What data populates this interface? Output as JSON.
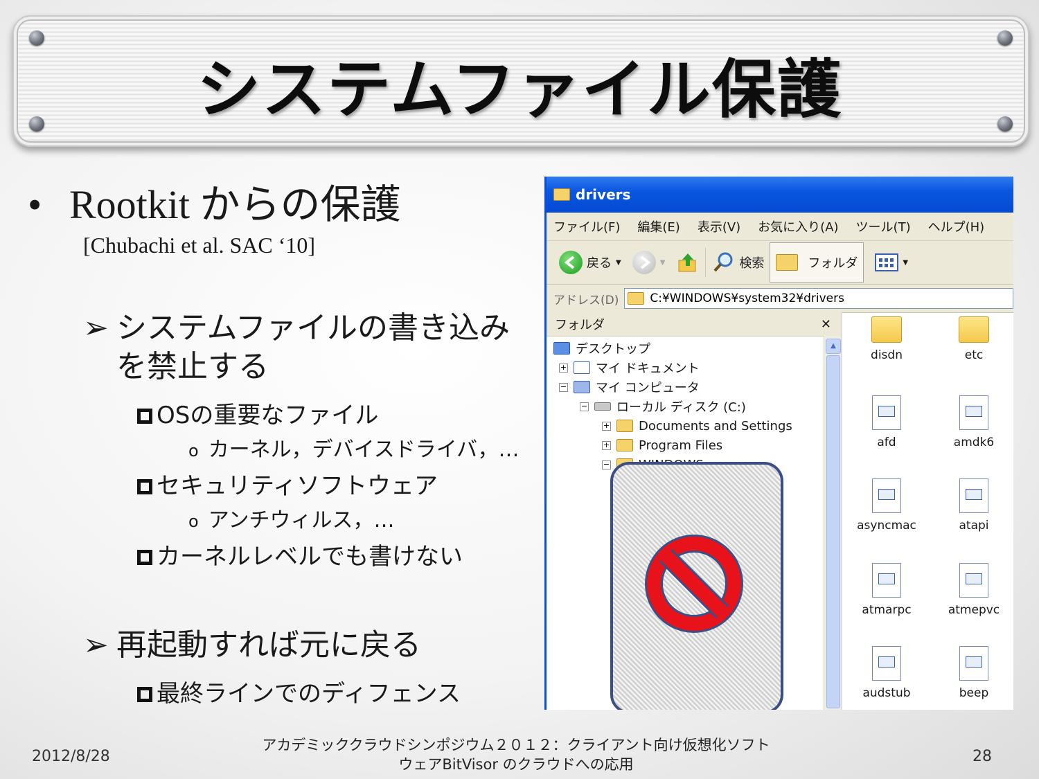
{
  "slide": {
    "title": "システムファイル保護",
    "bullet1": "Rootkit からの保護",
    "bullet1_marker": "•",
    "citation": "[Chubachi et al. SAC ‘10]",
    "sub1_line1": "システムファイルの書き込み",
    "sub1_line2": "を禁止する",
    "arrow": "➢",
    "items": [
      "OSの重要なファイル",
      "カーネル，デバイスドライバ，…",
      "セキュリティソフトウェア",
      "アンチウィルス，…",
      "カーネルレベルでも書けない"
    ],
    "sub2": "再起動すれば元に戻る",
    "sub2_item": "最終ラインでのディフェンス",
    "o_marker": "o"
  },
  "footer": {
    "date": "2012/8/28",
    "center_line1": "アカデミッククラウドシンポジウム２０１２：クライアント向け仮想化ソフト",
    "center_line2": "ウェアBitVisor のクラウドへの応用",
    "page": "28"
  },
  "explorer": {
    "title": "drivers",
    "menu": [
      "ファイル(F)",
      "編集(E)",
      "表示(V)",
      "お気に入り(A)",
      "ツール(T)",
      "ヘルプ(H)"
    ],
    "toolbar": {
      "back": "戻る",
      "search": "検索",
      "folders": "フォルダ"
    },
    "address_label": "アドレス(D)",
    "address_value": "C:¥WINDOWS¥system32¥drivers",
    "folders_pane_title": "フォルダ",
    "close_glyph": "✕",
    "tree": [
      "デスクトップ",
      "マイ ドキュメント",
      "マイ コンピュータ",
      "ローカル ディスク (C:)",
      "Documents and Settings",
      "Program Files",
      "WINDOWS"
    ],
    "files": [
      {
        "name": "disdn",
        "type": "folder"
      },
      {
        "name": "etc",
        "type": "folder"
      },
      {
        "name": "afd",
        "type": "file"
      },
      {
        "name": "amdk6",
        "type": "file"
      },
      {
        "name": "asyncmac",
        "type": "file"
      },
      {
        "name": "atapi",
        "type": "file"
      },
      {
        "name": "atmarpc",
        "type": "file"
      },
      {
        "name": "atmepvc",
        "type": "file"
      },
      {
        "name": "audstub",
        "type": "file"
      },
      {
        "name": "beep",
        "type": "file"
      }
    ],
    "colors": {
      "titlebar": "#0a57e0",
      "prohibition": "#e8121b"
    }
  }
}
